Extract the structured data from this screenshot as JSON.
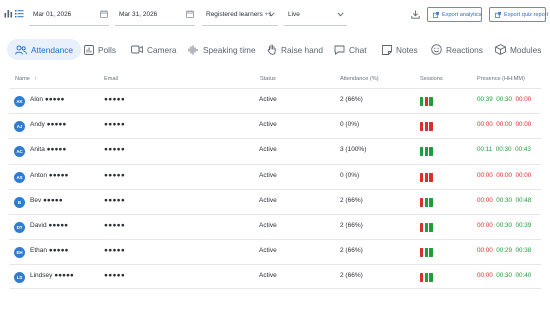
{
  "filters": {
    "start_date": "Mar 01, 2026",
    "end_date": "Mar 31, 2026",
    "learners": "Registered learners",
    "learners_extra": "+1",
    "status": "Live",
    "export_analytics": "Export analytics",
    "export_quiz": "Export quiz report"
  },
  "tabs": [
    {
      "label": "Attendance",
      "icon": "people-icon"
    },
    {
      "label": "Polls",
      "icon": "poll-icon"
    },
    {
      "label": "Camera",
      "icon": "camera-icon"
    },
    {
      "label": "Speaking time",
      "icon": "waveform-icon"
    },
    {
      "label": "Raise hand",
      "icon": "hand-icon"
    },
    {
      "label": "Chat",
      "icon": "chat-icon"
    },
    {
      "label": "Notes",
      "icon": "notes-icon"
    },
    {
      "label": "Reactions",
      "icon": "smiley-icon"
    },
    {
      "label": "Modules",
      "icon": "modules-icon"
    }
  ],
  "table": {
    "headers": {
      "name": "Name",
      "sort": "↑",
      "email": "Email",
      "status": "Status",
      "attendance": "Attendance (%)",
      "sessions": "Sessions",
      "presence": "Presence (HH:MM)"
    },
    "colors": {
      "present": "#1e9e3a",
      "absent": "#d9302b",
      "avatar": "#2f7dd3"
    },
    "rows": [
      {
        "initials": "AK",
        "name": "Alon ●●●●●",
        "email": "●●●●●",
        "status": "Active",
        "attendance": "2 (66%)",
        "sessions": [
          "present",
          "absent",
          "present"
        ],
        "presence": [
          "00:39",
          "00:30",
          "00:00"
        ]
      },
      {
        "initials": "AJ",
        "name": "Andy ●●●●●",
        "email": "●●●●●",
        "status": "Active",
        "attendance": "0 (0%)",
        "sessions": [
          "absent",
          "absent",
          "absent"
        ],
        "presence": [
          "00:00",
          "00:00",
          "00:00"
        ]
      },
      {
        "initials": "AC",
        "name": "Anita ●●●●●",
        "email": "●●●●●",
        "status": "Active",
        "attendance": "3 (100%)",
        "sessions": [
          "present",
          "present",
          "present"
        ],
        "presence": [
          "00:11",
          "00:30",
          "00:43"
        ]
      },
      {
        "initials": "AS",
        "name": "Anton ●●●●●",
        "email": "●●●●●",
        "status": "Active",
        "attendance": "0 (0%)",
        "sessions": [
          "absent",
          "absent",
          "absent"
        ],
        "presence": [
          "00:00",
          "00:00",
          "00:00"
        ]
      },
      {
        "initials": "B",
        "name": "Bev ●●●●●",
        "email": "●●●●●",
        "status": "Active",
        "attendance": "2 (66%)",
        "sessions": [
          "absent",
          "present",
          "present"
        ],
        "presence": [
          "00:00",
          "00:30",
          "00:48"
        ]
      },
      {
        "initials": "DT",
        "name": "David ●●●●●",
        "email": "●●●●●",
        "status": "Active",
        "attendance": "2 (66%)",
        "sessions": [
          "absent",
          "present",
          "present"
        ],
        "presence": [
          "00:00",
          "00:30",
          "00:39"
        ]
      },
      {
        "initials": "EH",
        "name": "Ethan ●●●●●",
        "email": "●●●●●",
        "status": "Active",
        "attendance": "2 (66%)",
        "sessions": [
          "absent",
          "present",
          "present"
        ],
        "presence": [
          "00:00",
          "00:29",
          "00:38"
        ]
      },
      {
        "initials": "LS",
        "name": "Lindsey ●●●●●",
        "email": "●●●●●",
        "status": "Active",
        "attendance": "2 (66%)",
        "sessions": [
          "absent",
          "present",
          "present"
        ],
        "presence": [
          "00:00",
          "00:30",
          "00:40"
        ]
      }
    ]
  }
}
